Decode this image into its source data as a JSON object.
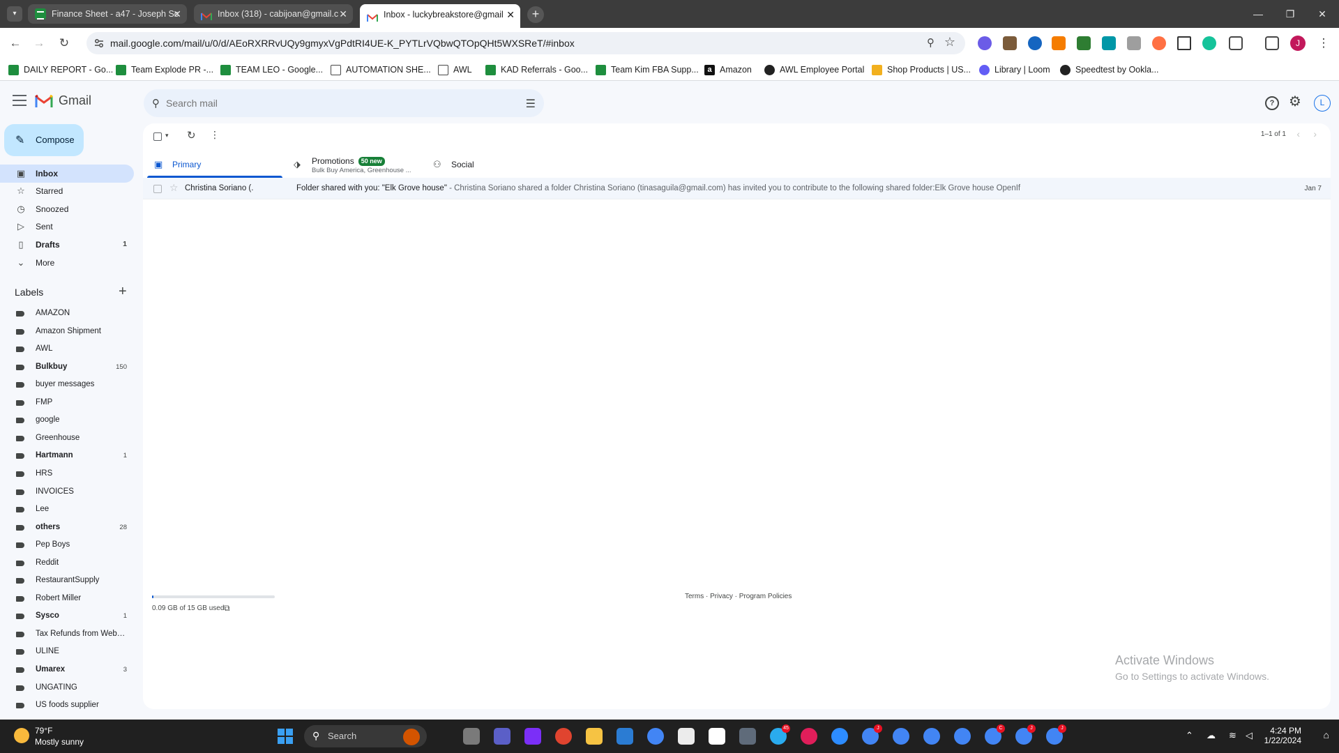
{
  "browser": {
    "tabs": [
      {
        "title": "Finance Sheet - a47 - Joseph Sc",
        "favicon": "sheets-icon",
        "active": false
      },
      {
        "title": "Inbox (318) - cabijoan@gmail.c",
        "favicon": "gmail-icon",
        "active": false
      },
      {
        "title": "Inbox - luckybreakstore@gmail",
        "favicon": "gmail-icon",
        "active": true
      }
    ],
    "url": "mail.google.com/mail/u/0/d/AEoRXRRvUQy9gmyxVgPdtRI4UE-K_PYTLrVQbwQTOpQHt5WXSReT/#inbox",
    "profile_initial": "J",
    "bookmarks": [
      {
        "label": "DAILY REPORT - Go...",
        "icon": "sheets-icon"
      },
      {
        "label": "Team Explode PR -...",
        "icon": "sheets-icon"
      },
      {
        "label": "TEAM LEO - Google...",
        "icon": "sheets-icon"
      },
      {
        "label": "AUTOMATION SHE...",
        "icon": "folder-icon"
      },
      {
        "label": "AWL",
        "icon": "folder-icon"
      },
      {
        "label": "KAD Referrals - Goo...",
        "icon": "sheets-icon"
      },
      {
        "label": "Team Kim FBA Supp...",
        "icon": "sheets-icon"
      },
      {
        "label": "Amazon",
        "icon": "amazon-icon"
      },
      {
        "label": "AWL Employee Portal",
        "icon": "circle-icon"
      },
      {
        "label": "Shop Products | US...",
        "icon": "us-icon"
      },
      {
        "label": "Library | Loom",
        "icon": "loom-icon"
      },
      {
        "label": "Speedtest by Ookla...",
        "icon": "speedtest-icon"
      }
    ]
  },
  "gmail": {
    "brand": "Gmail",
    "search_placeholder": "Search mail",
    "compose_label": "Compose",
    "account_initial": "L",
    "nav": [
      {
        "label": "Inbox",
        "icon": "inbox-icon",
        "count": "",
        "bold": true,
        "selected": true
      },
      {
        "label": "Starred",
        "icon": "star-icon",
        "count": "",
        "bold": false,
        "selected": false
      },
      {
        "label": "Snoozed",
        "icon": "clock-icon",
        "count": "",
        "bold": false,
        "selected": false
      },
      {
        "label": "Sent",
        "icon": "send-icon",
        "count": "",
        "bold": false,
        "selected": false
      },
      {
        "label": "Drafts",
        "icon": "draft-icon",
        "count": "1",
        "bold": true,
        "selected": false
      },
      {
        "label": "More",
        "icon": "chevron-down-icon",
        "count": "",
        "bold": false,
        "selected": false
      }
    ],
    "labels_title": "Labels",
    "labels": [
      {
        "name": "AMAZON",
        "count": "",
        "bold": false
      },
      {
        "name": "Amazon Shipment",
        "count": "",
        "bold": false
      },
      {
        "name": "AWL",
        "count": "",
        "bold": false
      },
      {
        "name": "Bulkbuy",
        "count": "150",
        "bold": true
      },
      {
        "name": "buyer messages",
        "count": "",
        "bold": false
      },
      {
        "name": "FMP",
        "count": "",
        "bold": false
      },
      {
        "name": "google",
        "count": "",
        "bold": false
      },
      {
        "name": "Greenhouse",
        "count": "",
        "bold": false
      },
      {
        "name": "Hartmann",
        "count": "1",
        "bold": true
      },
      {
        "name": "HRS",
        "count": "",
        "bold": false
      },
      {
        "name": "INVOICES",
        "count": "",
        "bold": false
      },
      {
        "name": "Lee",
        "count": "",
        "bold": false
      },
      {
        "name": "others",
        "count": "28",
        "bold": true
      },
      {
        "name": "Pep Boys",
        "count": "",
        "bold": false
      },
      {
        "name": "Reddit",
        "count": "",
        "bold": false
      },
      {
        "name": "RestaurantSupply",
        "count": "",
        "bold": false
      },
      {
        "name": "Robert Miller",
        "count": "",
        "bold": false
      },
      {
        "name": "Sysco",
        "count": "1",
        "bold": true
      },
      {
        "name": "Tax Refunds from Webst...",
        "count": "",
        "bold": false
      },
      {
        "name": "ULINE",
        "count": "",
        "bold": false
      },
      {
        "name": "Umarex",
        "count": "3",
        "bold": true
      },
      {
        "name": "UNGATING",
        "count": "",
        "bold": false
      },
      {
        "name": "US foods supplier",
        "count": "",
        "bold": false
      }
    ],
    "pager": "1–1 of 1",
    "categories": [
      {
        "label": "Primary",
        "icon": "inbox-icon",
        "sub": "",
        "badge": ""
      },
      {
        "label": "Promotions",
        "icon": "tag-icon",
        "sub": "Bulk Buy America, Greenhouse ...",
        "badge": "50 new"
      },
      {
        "label": "Social",
        "icon": "people-icon",
        "sub": "",
        "badge": ""
      }
    ],
    "emails": [
      {
        "sender": "Christina Soriano (.",
        "subject": "Folder shared with you: \"Elk Grove house\"",
        "snippet": " - Christina Soriano shared a folder Christina Soriano (tinasaguila@gmail.com) has invited you to contribute to the following shared folder:Elk Grove house OpenIf",
        "date": "Jan 7"
      }
    ],
    "storage_text": "0.09 GB of 15 GB used",
    "storage_fraction": 0.006,
    "footer": "Terms · Privacy · Program Policies"
  },
  "watermark": {
    "line1": "Activate Windows",
    "line2": "Go to Settings to activate Windows."
  },
  "taskbar": {
    "temp": "79°F",
    "condition": "Mostly sunny",
    "search_label": "Search",
    "time": "4:24 PM",
    "date": "1/22/2024"
  },
  "colors": {
    "accent": "#0b57d0",
    "compose_bg": "#c2e7ff",
    "selected_nav": "#d3e3fd",
    "badge_green": "#188038"
  }
}
